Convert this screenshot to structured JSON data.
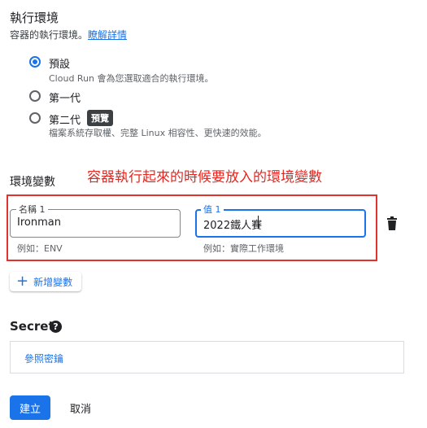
{
  "exec_env": {
    "title": "執行環境",
    "description": "容器的執行環境。",
    "learn_more": "瞭解詳情",
    "options": [
      {
        "label": "預設",
        "help": "Cloud Run 會為您選取適合的執行環境。",
        "selected": true
      },
      {
        "label": "第一代",
        "help": "",
        "selected": false
      },
      {
        "label": "第二代",
        "badge": "預覽",
        "help": "檔案系統存取權、完整 Linux 相容性、更快速的效能。",
        "selected": false
      }
    ]
  },
  "env_vars": {
    "title": "環境變數",
    "annotation": "容器執行起來的時候要放入的環境變數",
    "annotation_color": "#e8261f",
    "name_label": "名稱 1",
    "name_value": "Ironman",
    "name_hint": "例如：ENV",
    "value_label": "值 1",
    "value_value": "2022鐵人賽",
    "value_hint": "例如：實際工作環境",
    "add_button": "新增變數"
  },
  "secret": {
    "title": "Secret",
    "reference_link": "參照密鑰"
  },
  "footer": {
    "create": "建立",
    "cancel": "取消"
  },
  "colors": {
    "accent": "#1a73e8",
    "highlight_border": "#e0332d"
  }
}
